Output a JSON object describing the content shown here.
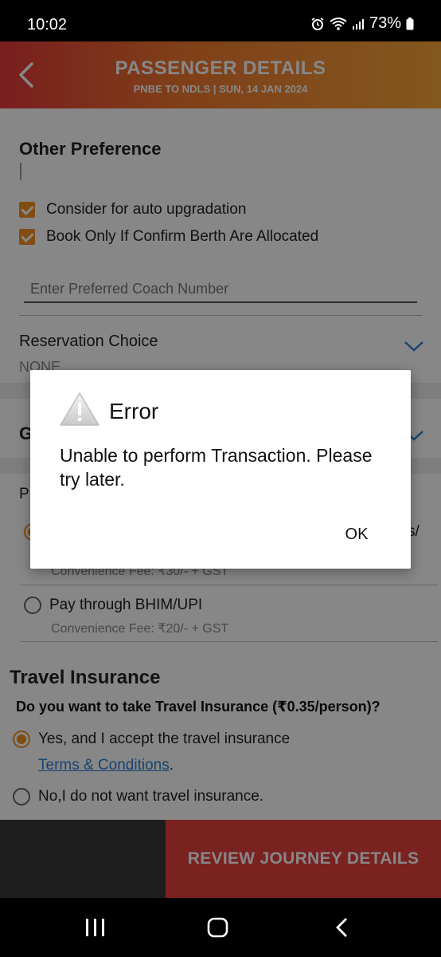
{
  "status_bar": {
    "time": "10:02",
    "battery": "73%",
    "icons": [
      "alarm-icon",
      "wifi-icon",
      "signal-icon",
      "battery-icon"
    ]
  },
  "header": {
    "title": "PASSENGER DETAILS",
    "route": "PNBE TO NDLS",
    "separator": "|",
    "date": "SUN, 14 JAN  2024",
    "back_icon": "chevron-left-icon"
  },
  "other_preference": {
    "heading": "Other Preference",
    "options": [
      {
        "label": "Consider for auto upgradation",
        "checked": true
      },
      {
        "label": "Book Only If Confirm Berth Are Allocated",
        "checked": true
      }
    ],
    "coach_placeholder": "Enter Preferred Coach Number",
    "reservation_choice_label": "Reservation Choice",
    "reservation_choice_value": "NONE"
  },
  "partial": {
    "g_letter": "G",
    "p_letter": "P",
    "s_fragment": "s/"
  },
  "payment": {
    "option1_fee": "Convenience Fee: ₹30/- + GST",
    "option2_label": "Pay through BHIM/UPI",
    "option2_fee": "Convenience Fee: ₹20/- + GST"
  },
  "insurance": {
    "title": "Travel Insurance",
    "question": "Do you want to take Travel Insurance (₹0.35/person)?",
    "yes_label": "Yes, and I accept the travel insurance",
    "terms_link": "Terms & Conditions",
    "terms_dot": ".",
    "no_label": "No,I do not want travel insurance."
  },
  "bottom": {
    "review_button": "REVIEW JOURNEY DETAILS"
  },
  "dialog": {
    "title": "Error",
    "message": "Unable to perform Transaction. Please try later.",
    "ok_button": "OK",
    "icon": "warning-icon"
  },
  "colors": {
    "accent_orange": "#f39021",
    "header_red": "#e6393b",
    "header_orange": "#f9a63a",
    "review_red": "#e5403e",
    "link_blue": "#2f7fd6"
  }
}
